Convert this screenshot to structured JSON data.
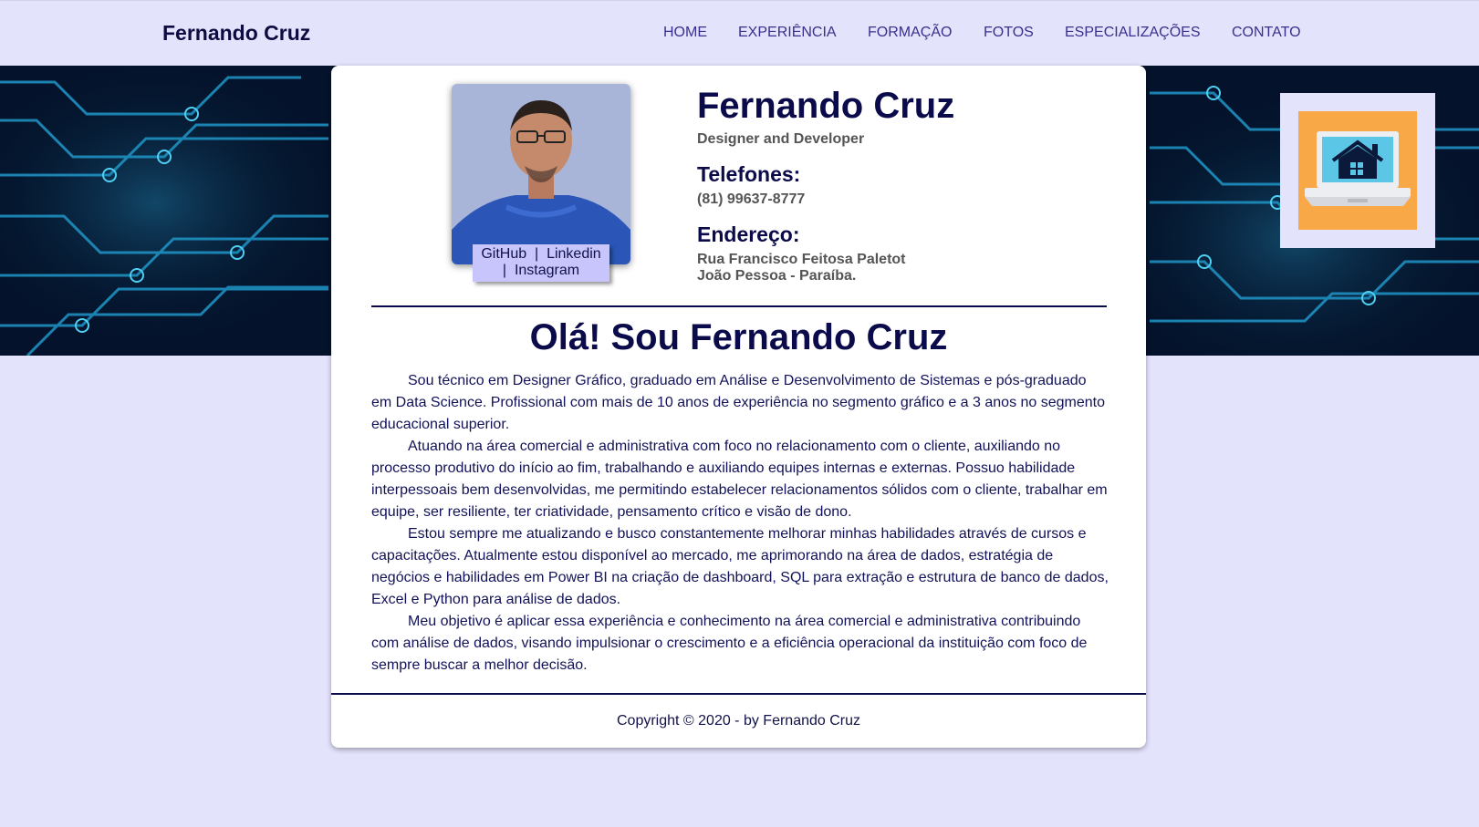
{
  "colors": {
    "page_bg": "#e4e3fc",
    "text_navy": "#0b0b4c",
    "nav_text": "#3a2f8c",
    "social_bg": "#c8c5fd",
    "banner_bg": "#04132b",
    "home_icon_bg": "#f8a846"
  },
  "header": {
    "brand": "Fernando Cruz",
    "nav": [
      "HOME",
      "EXPERIÊNCIA",
      "FORMAÇÃO",
      "FOTOS",
      "ESPECIALIZAÇÕES",
      "CONTATO"
    ]
  },
  "profile": {
    "name": "Fernando Cruz",
    "role": "Designer and Developer",
    "phones_heading": "Telefones:",
    "phone": "(81) 99637-8777",
    "address_heading": "Endereço:",
    "address_line1": "Rua Francisco Feitosa Paletot",
    "address_line2": "João Pessoa - Paraíba.",
    "social": {
      "github": "GitHub",
      "separator": "|",
      "linkedin": "Linkedin",
      "instagram": "Instagram"
    }
  },
  "main": {
    "greeting": "Olá! Sou Fernando Cruz",
    "paragraphs": [
      "Sou técnico em Designer Gráfico, graduado em Análise e Desenvolvimento de Sistemas e pós-graduado em Data Science. Profissional com mais de 10 anos de experiência no segmento gráfico e a 3 anos no segmento educacional superior.",
      "Atuando na área comercial e administrativa com foco no relacionamento com o cliente, auxiliando no processo produtivo do início ao fim, trabalhando e auxiliando equipes internas e externas. Possuo habilidade interpessoais bem desenvolvidas, me permitindo estabelecer relacionamentos sólidos com o cliente, trabalhar em equipe, ser resiliente, ter criatividade, pensamento crítico e visão de dono.",
      "Estou sempre me atualizando e busco constantemente melhorar minhas habilidades através de cursos e capacitações. Atualmente estou disponível ao mercado, me aprimorando na área de dados, estratégia de negócios e habilidades em Power BI na criação de dashboard, SQL para extração e estrutura de banco de dados, Excel e Python para análise de dados.",
      "Meu objetivo é aplicar essa experiência e conhecimento na área comercial e administrativa contribuindo com análise de dados, visando impulsionar o crescimento e a eficiência operacional da instituição com foco de sempre buscar a melhor decisão."
    ]
  },
  "footer": {
    "copyright": "Copyright © 2020 - by Fernando Cruz"
  },
  "icons": {
    "home_button": "laptop-home-icon",
    "banner": "circuit-board-background",
    "photo": "profile-photo"
  }
}
